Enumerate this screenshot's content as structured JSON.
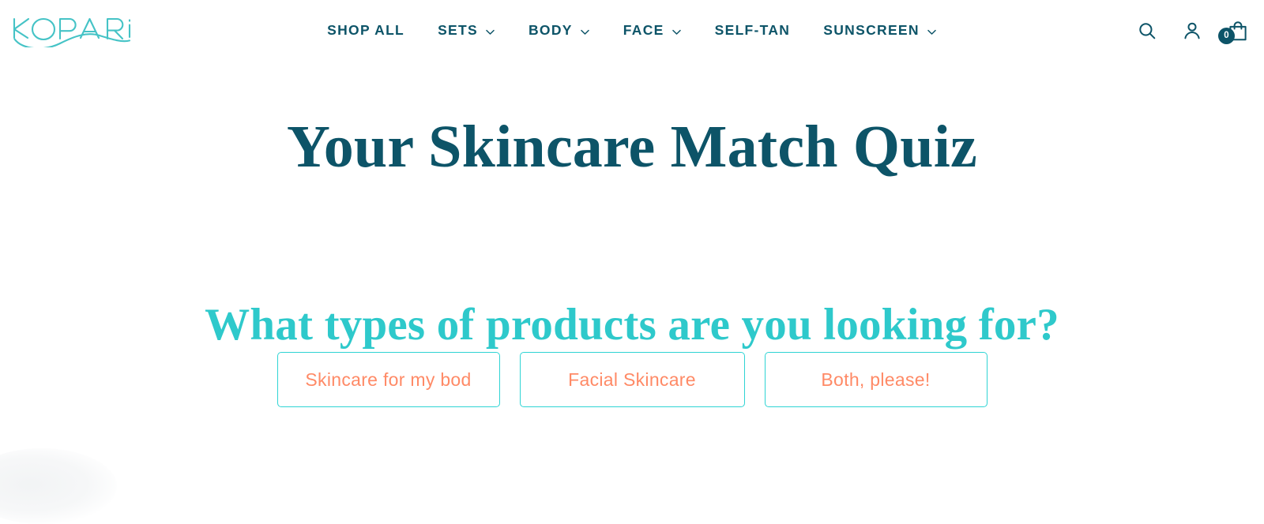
{
  "brand": {
    "logo_text": "KOPARi",
    "logo_color": "#45C3C6"
  },
  "header": {
    "nav": [
      {
        "label": "SHOP ALL",
        "has_dropdown": false
      },
      {
        "label": "SETS",
        "has_dropdown": true
      },
      {
        "label": "BODY",
        "has_dropdown": true
      },
      {
        "label": "FACE",
        "has_dropdown": true
      },
      {
        "label": "SELF-TAN",
        "has_dropdown": false
      },
      {
        "label": "SUNSCREEN",
        "has_dropdown": true
      }
    ],
    "nav_color": "#0D5468",
    "actions": {
      "search_icon": "search-icon",
      "account_icon": "user-account-icon",
      "cart_icon": "shopping-bag-icon",
      "cart_count": "0"
    }
  },
  "quiz": {
    "title": "Your Skincare Match Quiz",
    "title_color": "#0D5468",
    "question": "What types of products are you looking for?",
    "question_color": "#2EC9CB",
    "answers": [
      {
        "label": "Skincare for my bod"
      },
      {
        "label": "Facial Skincare"
      },
      {
        "label": "Both, please!"
      }
    ],
    "answer_border_color": "#2FD4D4",
    "answer_text_color": "#FF8A66"
  },
  "chat": {
    "widget_name": "chat-launcher"
  }
}
